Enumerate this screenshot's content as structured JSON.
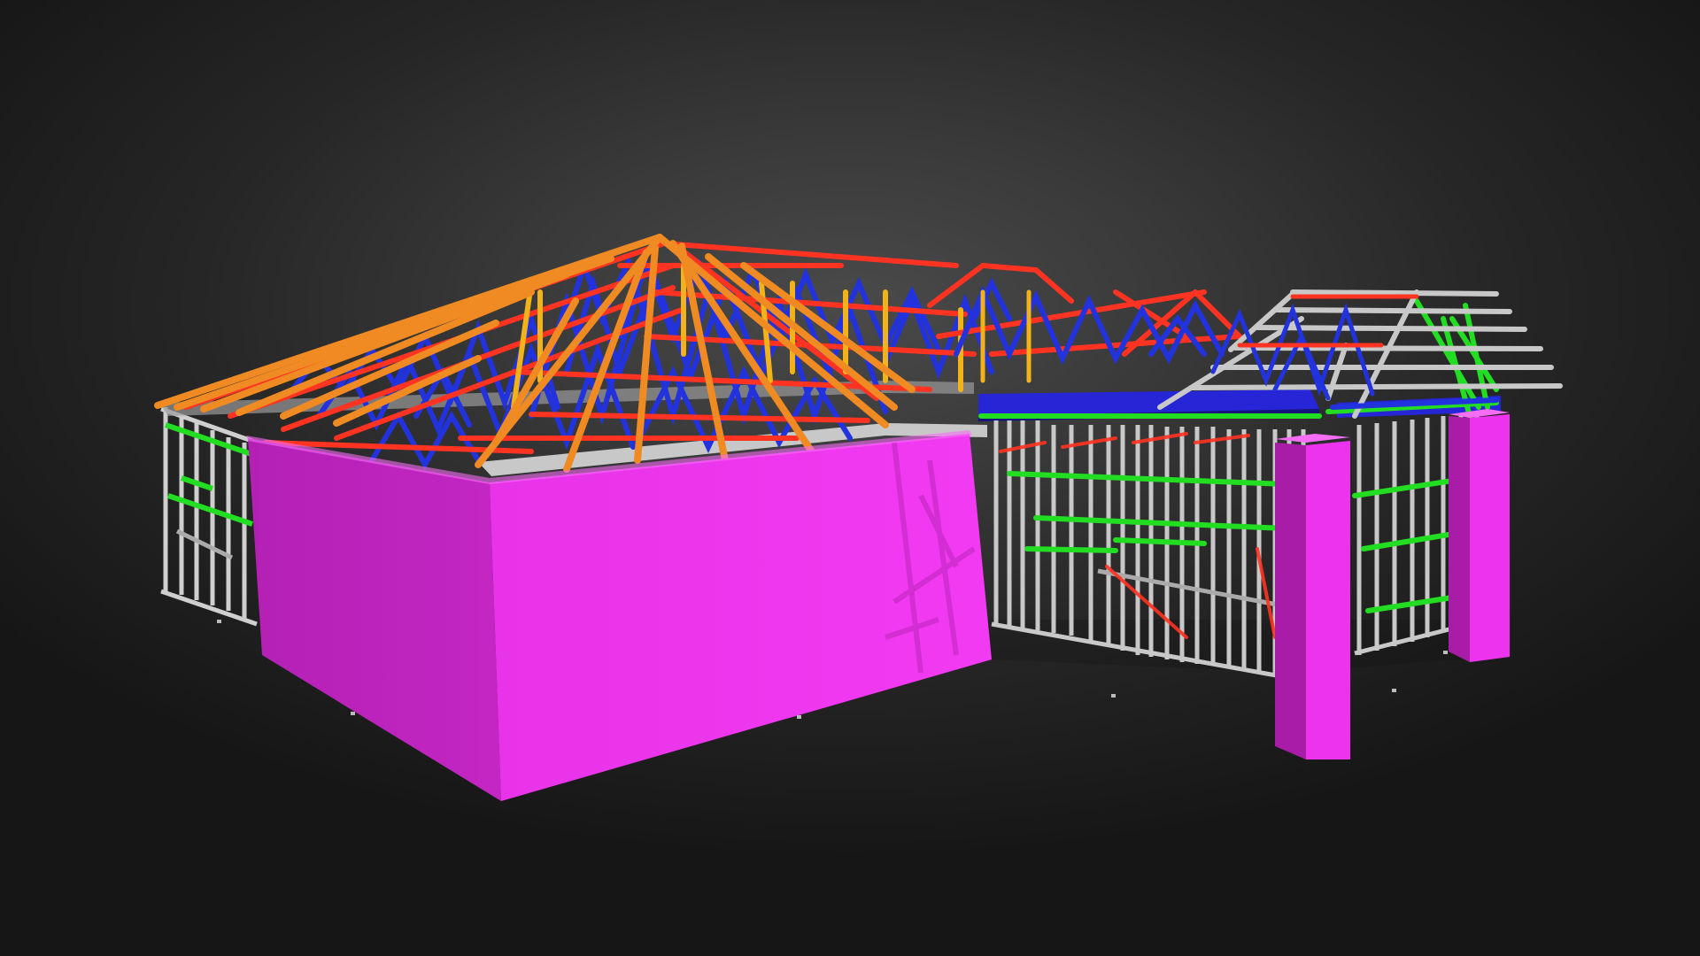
{
  "colors": {
    "background": "#2b2b2b",
    "wall_panel": "#e62ee6",
    "wall_panel_dark": "#a81ca8",
    "hip_rafter": "#f08a22",
    "top_chord": "#ff3322",
    "web_member": "#2233dd",
    "vertical_post": "#f2b21a",
    "stud": "#c8c8c8",
    "nogging": "#22dd22",
    "beam": "#2626d6"
  },
  "scene": {
    "model": "steel-frame-house",
    "components": [
      "wall-panels",
      "roof-trusses",
      "hip-rafters",
      "wall-studs",
      "noggings",
      "beams",
      "posts"
    ]
  }
}
